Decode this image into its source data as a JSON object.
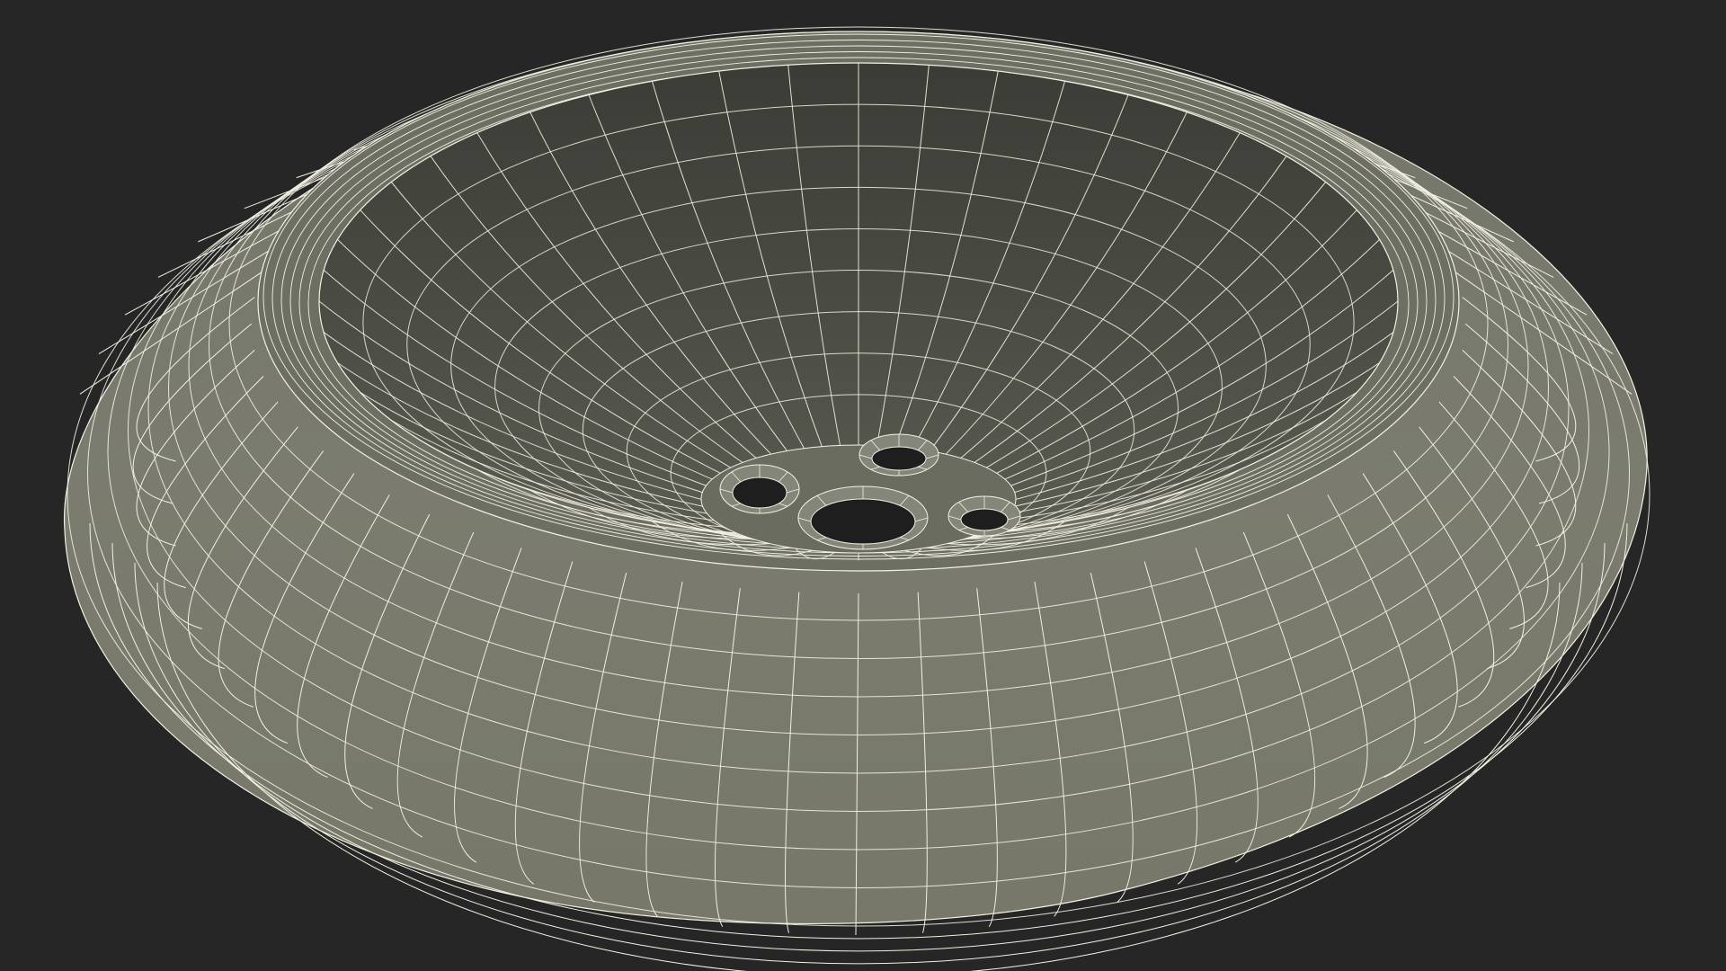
{
  "scene": {
    "subject": "wireframe-sink-bowl",
    "colors": {
      "background": "#262626",
      "surface_outer": "#7a7b6e",
      "surface_outer_dark": "#6c6d61",
      "surface_inner": "#4b4c44",
      "surface_inner_dark": "#3d3e38",
      "wire": "#f2f1e3",
      "hole": "#1e1e1e"
    },
    "mesh": {
      "outer_meridians": 64,
      "inner_meridians": 48,
      "outer_rings": 9,
      "inner_rings": 8,
      "drain_holes": 4
    }
  }
}
